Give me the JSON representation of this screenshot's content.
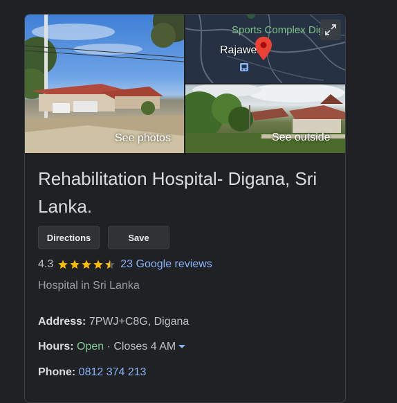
{
  "photos": {
    "see_photos_label": "See photos",
    "see_outside_label": "See outside",
    "map": {
      "place_label": "Rajawella",
      "poi_label": "Sports Complex Dig"
    }
  },
  "place": {
    "title": "Rehabilitation Hospital- Digana, Sri Lanka.",
    "category": "Hospital in Sri Lanka"
  },
  "actions": {
    "directions_label": "Directions",
    "save_label": "Save"
  },
  "rating": {
    "value": "4.3",
    "stars": 4.3,
    "reviews_label": "23 Google reviews"
  },
  "details": {
    "address_label": "Address:",
    "address_value": "7PWJ+C8G, Digana",
    "hours_label": "Hours:",
    "hours_status": "Open",
    "hours_separator": " · ",
    "hours_closes": "Closes 4 AM",
    "phone_label": "Phone:",
    "phone_value": "0812 374 213"
  },
  "colors": {
    "background": "#202124",
    "link": "#8ab4f8",
    "open": "#81c995",
    "star": "#fbbc04",
    "map_pin": "#ea4335"
  }
}
